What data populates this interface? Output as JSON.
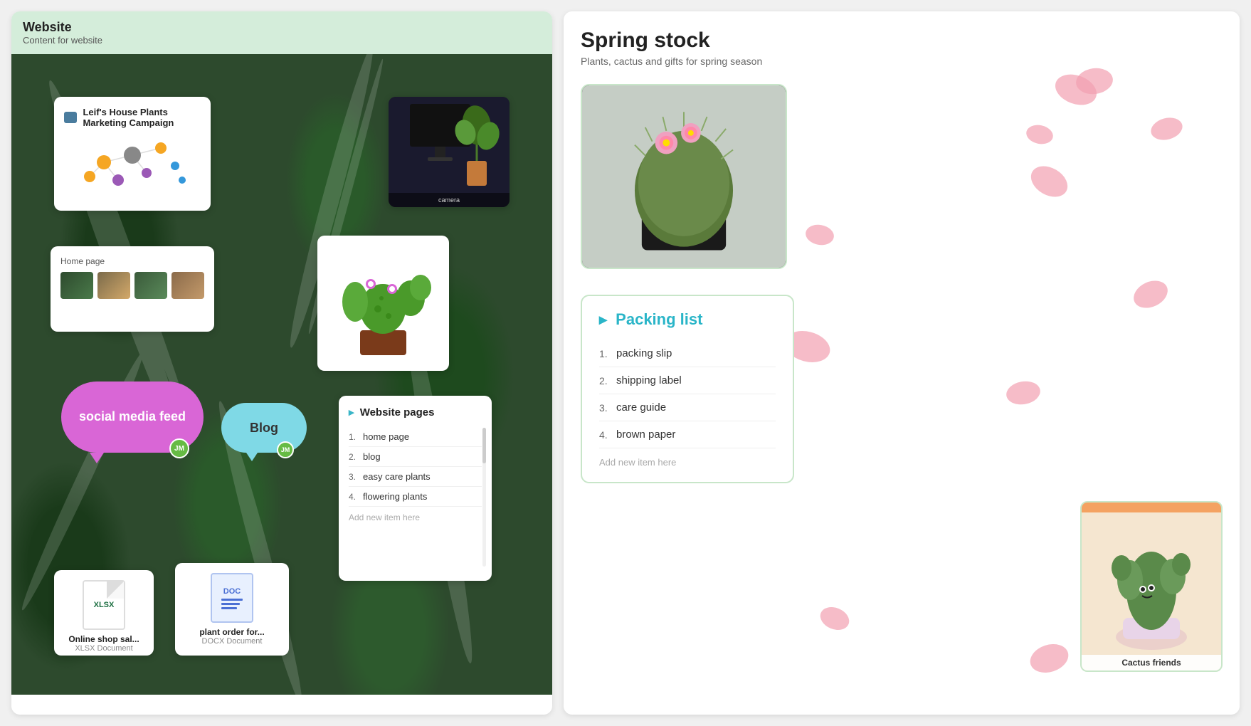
{
  "left_panel": {
    "title": "Website",
    "subtitle": "Content for website",
    "marketing_card": {
      "icon_label": "link-icon",
      "title": "Leif's House Plants\nMarketing Campaign"
    },
    "homepage_card": {
      "label": "Home page"
    },
    "social_bubble": {
      "text": "social media feed",
      "avatar": "JM"
    },
    "blog_bubble": {
      "text": "Blog",
      "avatar": "JM"
    },
    "webpages_card": {
      "title": "Website pages",
      "items": [
        {
          "num": "1.",
          "label": "home page"
        },
        {
          "num": "2.",
          "label": "blog"
        },
        {
          "num": "3.",
          "label": "easy care plants"
        },
        {
          "num": "4.",
          "label": "flowering plants"
        }
      ],
      "add_item": "Add new item here"
    },
    "xlsx_card": {
      "name": "Online shop sal...",
      "type": "XLSX Document",
      "ext": "XLSX"
    },
    "docx_card": {
      "name": "plant order for...",
      "type": "DOCX Document",
      "ext": "DOC"
    }
  },
  "right_panel": {
    "title": "Spring stock",
    "subtitle": "Plants, cactus and gifts for spring season",
    "packing_list": {
      "title": "Packing list",
      "items": [
        {
          "num": "1.",
          "label": "packing slip"
        },
        {
          "num": "2.",
          "label": "shipping label"
        },
        {
          "num": "3.",
          "label": "care guide"
        },
        {
          "num": "4.",
          "label": "brown paper"
        }
      ],
      "add_item": "Add new item here"
    },
    "cactus_photo_label": "Cactus friends"
  }
}
